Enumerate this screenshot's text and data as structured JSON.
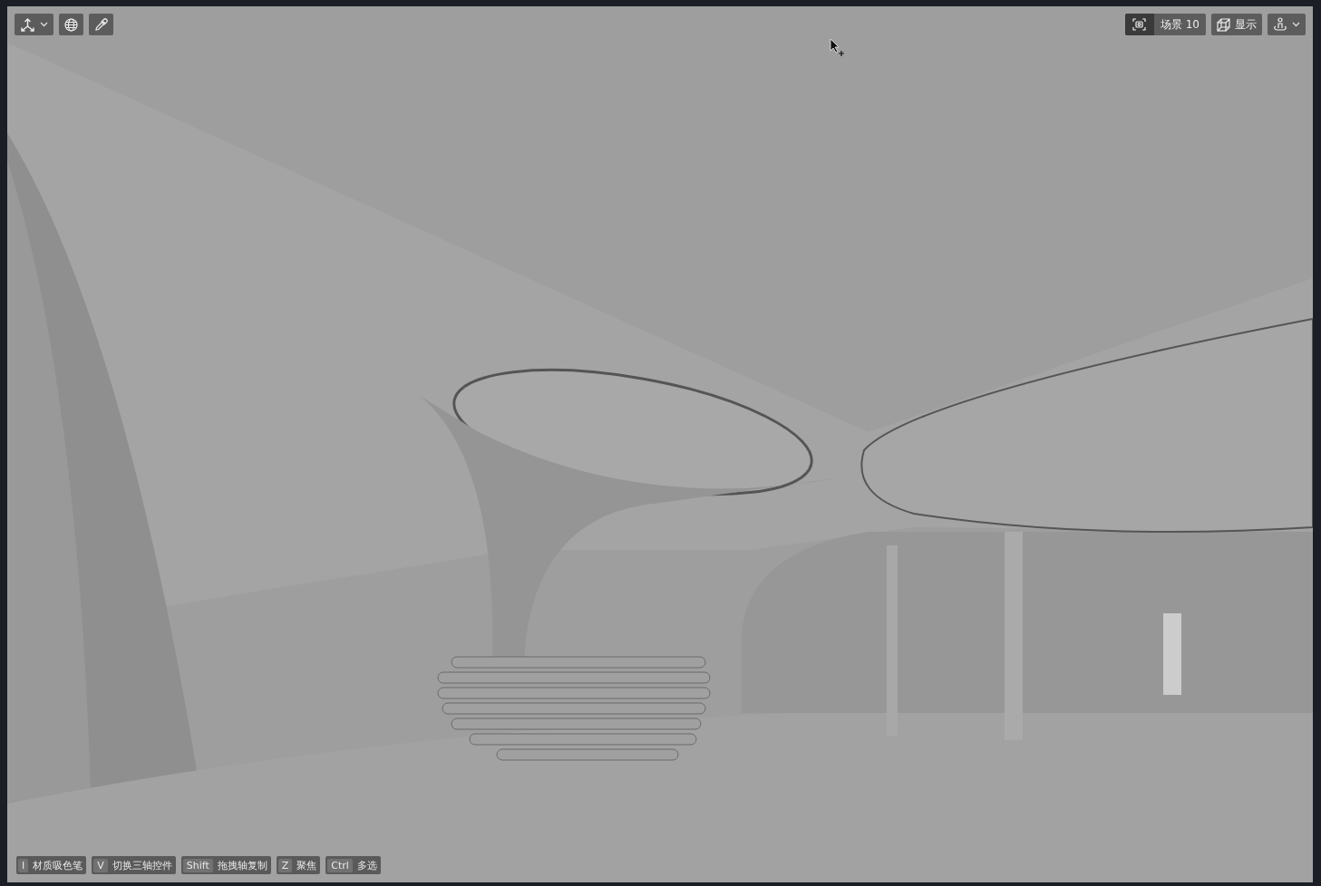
{
  "viewport": {
    "scene_button": {
      "label": "场景 10"
    },
    "display_button": {
      "label": "显示"
    }
  },
  "shortcuts": [
    {
      "key": "I",
      "label": "材质吸色笔"
    },
    {
      "key": "V",
      "label": "切换三轴控件"
    },
    {
      "key": "Shift",
      "label": "拖拽轴复制"
    },
    {
      "key": "Z",
      "label": "聚焦"
    },
    {
      "key": "Ctrl",
      "label": "多选"
    }
  ]
}
